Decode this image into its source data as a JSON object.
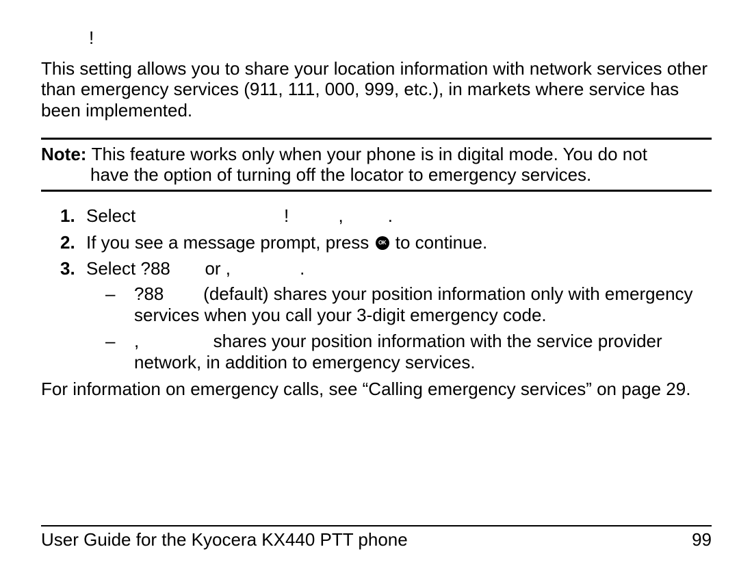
{
  "heading": {
    "marker": "!"
  },
  "intro": "This setting allows you to share your location information with network services other than emergency services (911, 111, 000, 999, etc.), in markets where service has been implemented.",
  "note": {
    "label": "Note: ",
    "line1": "This feature works only when your phone is in digital mode. You do not",
    "line2": "have the option of turning off the locator to emergency services."
  },
  "steps": {
    "s1": {
      "lead": "Select ",
      "mid_gap": "                             ",
      "bang": "!",
      "sep1": "          ,",
      "tail": "         ."
    },
    "s2": {
      "lead": "If you see a message prompt, press ",
      "tail": " to continue."
    },
    "s3": {
      "lead": "Select ",
      "opt_a": "?88",
      "mid": "       or ,",
      "tail": "              .",
      "sub": {
        "a": {
          "code": "?88",
          "rest": "        (default) shares your position information only with emergency services when you call your 3-digit emergency code."
        },
        "b": {
          "lead": ",",
          "rest": "               shares your position information with the service provider network, in addition to emergency services."
        }
      }
    }
  },
  "follow": "For information on emergency calls, see “Calling emergency services” on page 29.",
  "footer": {
    "left": "User Guide for the Kyocera KX440 PTT phone",
    "right": "99"
  }
}
